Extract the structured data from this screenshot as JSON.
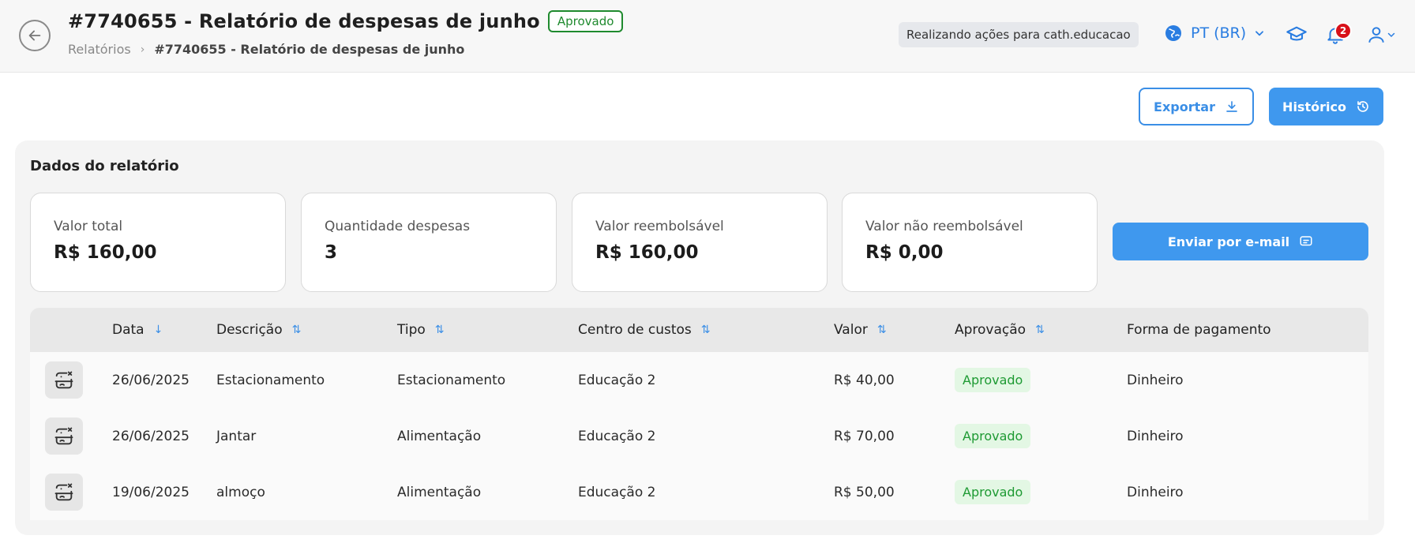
{
  "header": {
    "title": "#7740655 - Relatório de despesas de junho",
    "status": "Aprovado",
    "breadcrumb": {
      "parent": "Relatórios",
      "current": "#7740655 - Relatório de despesas de junho"
    },
    "acting_as": "Realizando ações para cath.educacao",
    "language": "PT (BR)",
    "notification_count": "2",
    "icons": [
      "arrow-left-icon",
      "globe-icon",
      "chevron-down-icon",
      "graduation-cap-icon",
      "bell-icon",
      "user-icon"
    ]
  },
  "actions": {
    "export_label": "Exportar",
    "history_label": "Histórico"
  },
  "report": {
    "section_title": "Dados do relatório",
    "cards": [
      {
        "label": "Valor total",
        "value": "R$ 160,00"
      },
      {
        "label": "Quantidade despesas",
        "value": "3"
      },
      {
        "label": "Valor reembolsável",
        "value": "R$ 160,00"
      },
      {
        "label": "Valor não reembolsável",
        "value": "R$ 0,00"
      }
    ],
    "email_button": "Enviar por e-mail"
  },
  "table": {
    "columns": [
      "Data",
      "Descrição",
      "Tipo",
      "Centro de custos",
      "Valor",
      "Aprovação",
      "Forma de pagamento"
    ],
    "rows": [
      {
        "date": "26/06/2025",
        "description": "Estacionamento",
        "type": "Estacionamento",
        "cost_center": "Educação 2",
        "value": "R$ 40,00",
        "approval": "Aprovado",
        "payment": "Dinheiro"
      },
      {
        "date": "26/06/2025",
        "description": "Jantar",
        "type": "Alimentação",
        "cost_center": "Educação 2",
        "value": "R$ 70,00",
        "approval": "Aprovado",
        "payment": "Dinheiro"
      },
      {
        "date": "19/06/2025",
        "description": "almoço",
        "type": "Alimentação",
        "cost_center": "Educação 2",
        "value": "R$ 50,00",
        "approval": "Aprovado",
        "payment": "Dinheiro"
      }
    ]
  },
  "colors": {
    "accent": "#3f98ee",
    "approved": "#1e9a33",
    "notification": "#d8111a"
  }
}
